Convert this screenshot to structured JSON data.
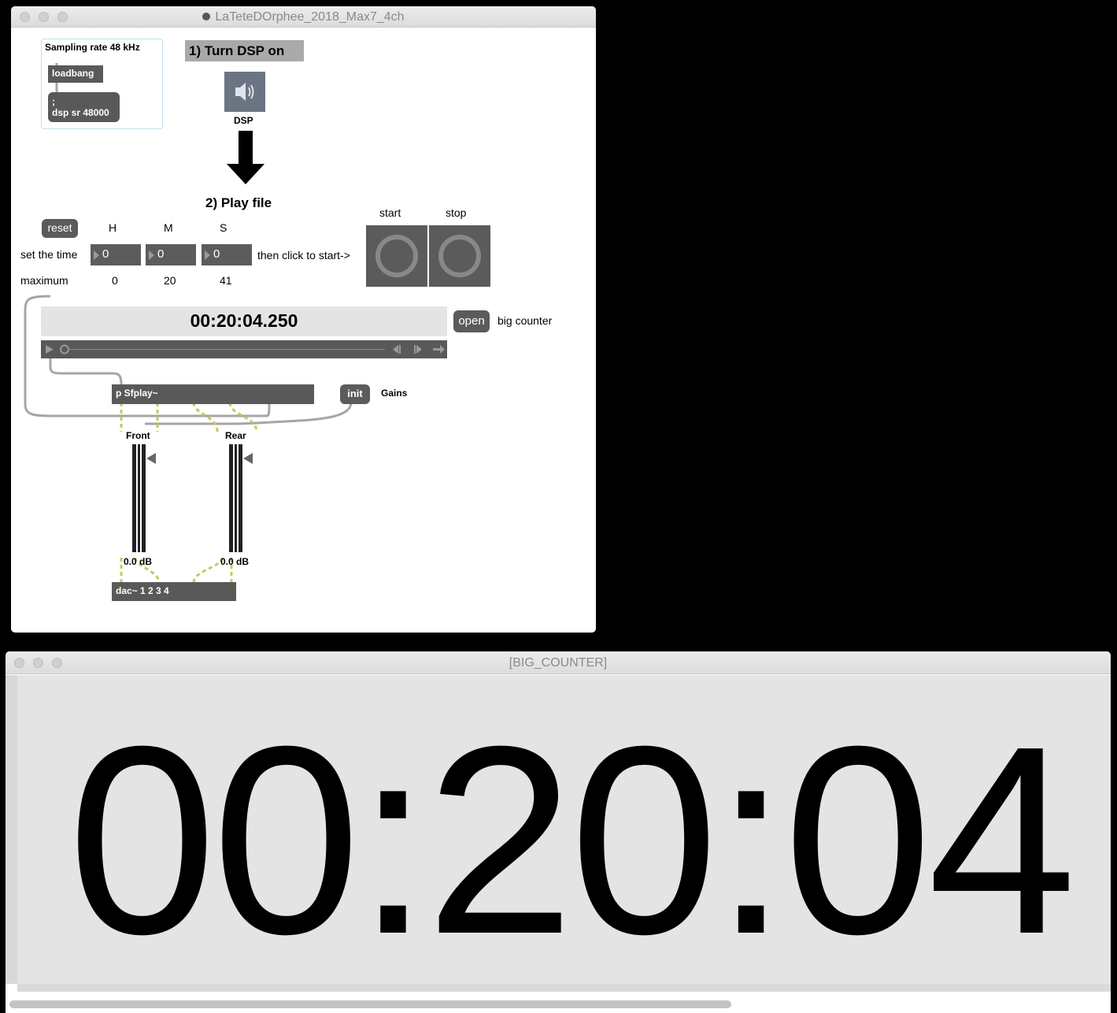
{
  "main_window": {
    "title": "LaTeteDOrphee_2018_Max7_4ch",
    "sampling": {
      "comment": "Sampling rate 48 kHz",
      "loadbang": "loadbang",
      "message_line1": ";",
      "message_line2": "dsp sr 48000"
    },
    "step1": "1) Turn DSP on",
    "dsp_label": "DSP",
    "step2": "2) Play file",
    "reset": "reset",
    "time_headers": {
      "h": "H",
      "m": "M",
      "s": "S"
    },
    "set_time_label": "set the time",
    "time_inputs": {
      "h": "0",
      "m": "0",
      "s": "0"
    },
    "then_click": "then click to start->",
    "start_label": "start",
    "stop_label": "stop",
    "maximum_label": "maximum",
    "maximum_values": {
      "h": "0",
      "m": "20",
      "s": "41"
    },
    "counter_display": "00:20:04.250",
    "open_button": "open",
    "big_counter_label": "big counter",
    "sfplay_object": "p Sfplay~",
    "init_button": "init",
    "gains_label": "Gains",
    "front_label": "Front",
    "rear_label": "Rear",
    "front_db": "0.0 dB",
    "rear_db": "0.0 dB",
    "dac_object": "dac~ 1 2 3 4"
  },
  "counter_window": {
    "title": "[BIG_COUNTER]",
    "display": "00:20:04"
  },
  "colors": {
    "object_bg": "#595959",
    "patch_cord": "#a0a0a0",
    "signal_cord": "#c8c85a",
    "counter_bg": "#e4e4e4"
  },
  "icons": {
    "dsp_toggle": "speaker-icon",
    "transport_play": "play-icon",
    "transport_prev": "step-back-icon",
    "transport_next": "step-forward-icon",
    "transport_loop": "arrow-right-icon"
  }
}
